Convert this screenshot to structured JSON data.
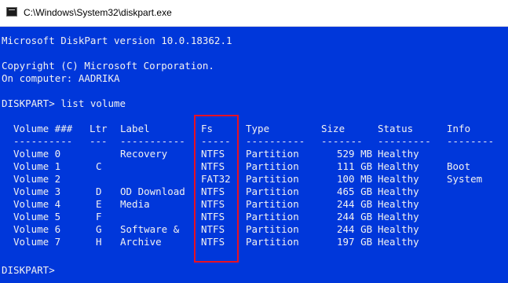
{
  "window": {
    "title": "C:\\Windows\\System32\\diskpart.exe"
  },
  "console": {
    "version_line": "Microsoft DiskPart version 10.0.18362.1",
    "copyright_line": "Copyright (C) Microsoft Corporation.",
    "computer_line": "On computer: AADRIKA",
    "command_line": "DISKPART> list volume",
    "prompt": "DISKPART>"
  },
  "table": {
    "headers": {
      "volume": "Volume ###",
      "ltr": "Ltr",
      "label": "Label",
      "fs": "Fs",
      "type": "Type",
      "size": "Size",
      "status": "Status",
      "info": "Info"
    },
    "separators": {
      "volume": "----------",
      "ltr": "---",
      "label": "-----------",
      "fs": "-----",
      "type": "----------",
      "size": "-------",
      "status": "---------",
      "info": "--------"
    },
    "rows": [
      {
        "volume": "Volume 0",
        "ltr": "",
        "label": "Recovery",
        "fs": "NTFS",
        "type": "Partition",
        "size": "529 MB",
        "status": "Healthy",
        "info": ""
      },
      {
        "volume": "Volume 1",
        "ltr": "C",
        "label": "",
        "fs": "NTFS",
        "type": "Partition",
        "size": "111 GB",
        "status": "Healthy",
        "info": "Boot"
      },
      {
        "volume": "Volume 2",
        "ltr": "",
        "label": "",
        "fs": "FAT32",
        "type": "Partition",
        "size": "100 MB",
        "status": "Healthy",
        "info": "System"
      },
      {
        "volume": "Volume 3",
        "ltr": "D",
        "label": "OD Download",
        "fs": "NTFS",
        "type": "Partition",
        "size": "465 GB",
        "status": "Healthy",
        "info": ""
      },
      {
        "volume": "Volume 4",
        "ltr": "E",
        "label": "Media",
        "fs": "NTFS",
        "type": "Partition",
        "size": "244 GB",
        "status": "Healthy",
        "info": ""
      },
      {
        "volume": "Volume 5",
        "ltr": "F",
        "label": "",
        "fs": "NTFS",
        "type": "Partition",
        "size": "244 GB",
        "status": "Healthy",
        "info": ""
      },
      {
        "volume": "Volume 6",
        "ltr": "G",
        "label": "Software &",
        "fs": "NTFS",
        "type": "Partition",
        "size": "244 GB",
        "status": "Healthy",
        "info": ""
      },
      {
        "volume": "Volume 7",
        "ltr": "H",
        "label": "Archive",
        "fs": "NTFS",
        "type": "Partition",
        "size": "197 GB",
        "status": "Healthy",
        "info": ""
      }
    ]
  },
  "colors": {
    "console_background": "#0037da",
    "console_text": "#f2f2f2",
    "highlight_border": "#e81123"
  }
}
